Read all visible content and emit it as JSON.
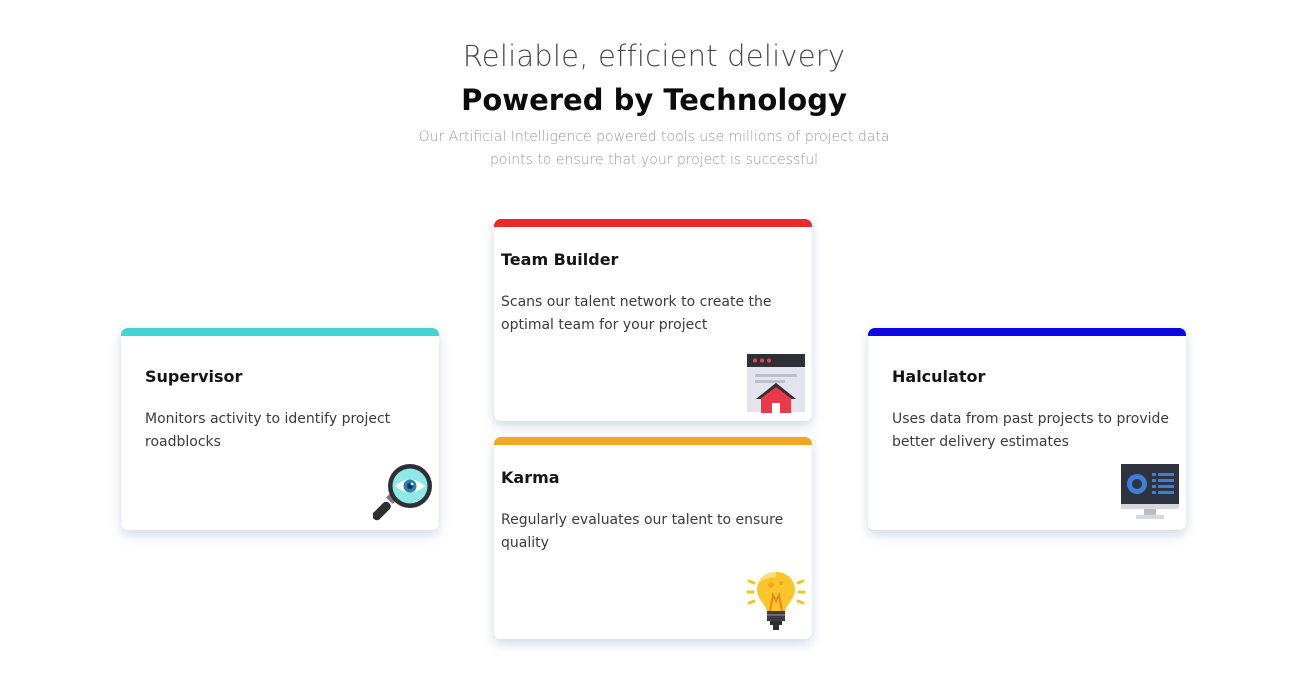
{
  "hero": {
    "subtitle": "Reliable, efficient delivery",
    "title": "Powered by Technology",
    "description": "Our Artificial Intelligence powered tools use millions of project data points to ensure that your project is successful"
  },
  "cards": {
    "supervisor": {
      "title": "Supervisor",
      "description": "Monitors activity to identify project roadblocks",
      "accent_color": "#44d3d2",
      "icon": "magnifier-eye-icon"
    },
    "team_builder": {
      "title": "Team Builder",
      "description": "Scans our talent network to create the optimal team for your project",
      "accent_color": "#ea2a2a",
      "icon": "browser-home-icon"
    },
    "karma": {
      "title": "Karma",
      "description": "Regularly evaluates our talent to ensure quality",
      "accent_color": "#f3a525",
      "icon": "lightbulb-icon"
    },
    "calculator": {
      "title": "Halculator",
      "description": "Uses data from past projects to provide better delivery estimates",
      "accent_color": "#0e05e4",
      "icon": "monitor-dashboard-icon"
    }
  }
}
